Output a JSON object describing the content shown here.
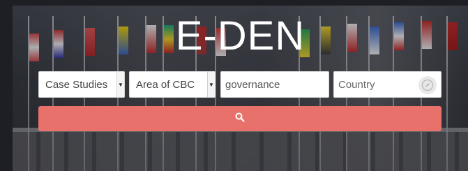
{
  "brand": {
    "title": "E-DEN"
  },
  "filters": {
    "category": {
      "value": "Case Studies"
    },
    "area": {
      "value": "Area of CBC"
    },
    "keyword": {
      "value": "governance"
    },
    "country": {
      "placeholder": "Country"
    }
  },
  "icons": {
    "locate": "compass-icon",
    "search": "search-icon"
  },
  "colors": {
    "accent": "#e8726b",
    "text": "#ffffff"
  }
}
